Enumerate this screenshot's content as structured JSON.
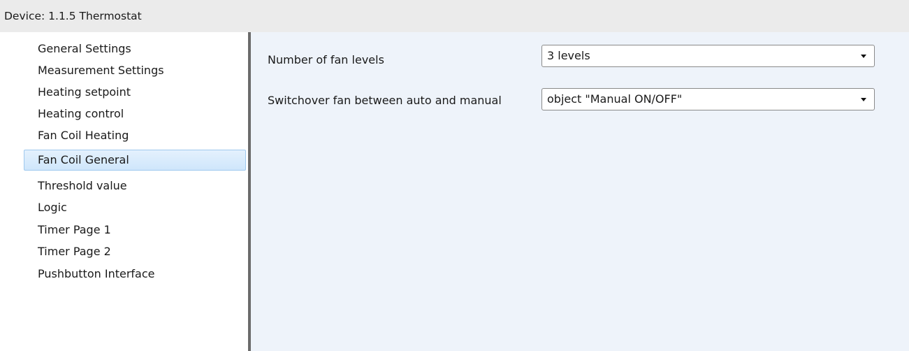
{
  "window": {
    "title": "Device: 1.1.5  Thermostat"
  },
  "sidebar": {
    "items": [
      {
        "label": "General Settings"
      },
      {
        "label": "Measurement Settings"
      },
      {
        "label": "Heating setpoint"
      },
      {
        "label": "Heating control"
      },
      {
        "label": "Fan Coil Heating"
      },
      {
        "label": "Fan Coil General"
      },
      {
        "label": "Threshold value"
      },
      {
        "label": "Logic"
      },
      {
        "label": "Timer Page 1"
      },
      {
        "label": "Timer Page 2"
      },
      {
        "label": "Pushbutton Interface"
      }
    ],
    "selected": "Fan Coil General"
  },
  "parameters": {
    "fan_levels": {
      "label": "Number of fan levels",
      "value": "3 levels"
    },
    "switchover": {
      "label": "Switchover fan between auto and manual",
      "value": "object \"Manual ON/OFF\""
    }
  },
  "colors": {
    "content_bg": "#eef3fa",
    "selected_bg": "#cfe6fb",
    "selected_border": "#9fc9ee",
    "splitter": "#6b6b6b"
  },
  "icons": {
    "dropdown": "chevron-down-icon"
  }
}
